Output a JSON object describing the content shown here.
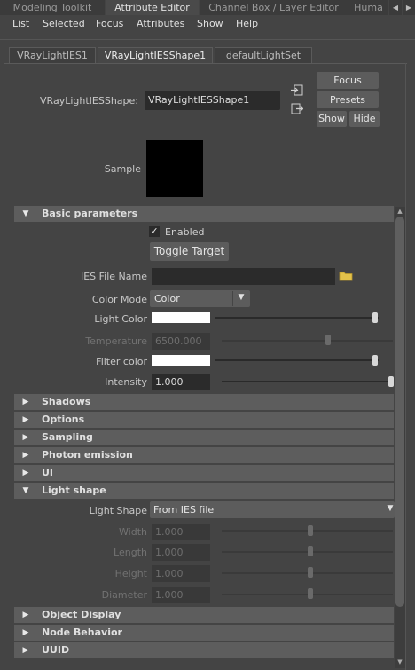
{
  "panel_tabs": [
    "Modeling Toolkit",
    "Attribute Editor",
    "Channel Box / Layer Editor",
    "Huma"
  ],
  "menu": [
    "List",
    "Selected",
    "Focus",
    "Attributes",
    "Show",
    "Help"
  ],
  "node_tabs": [
    "VRayLightIES1",
    "VRayLightIESShape1",
    "defaultLightSet"
  ],
  "header": {
    "node_label": "VRayLightIESShape:",
    "node_name": "VRayLightIESShape1",
    "focus": "Focus",
    "presets": "Presets",
    "show": "Show",
    "hide": "Hide",
    "sample_label": "Sample"
  },
  "basic": {
    "title": "Basic parameters",
    "enabled_label": "Enabled",
    "enabled": true,
    "toggle_target": "Toggle Target",
    "ies_file_label": "IES File Name",
    "ies_file_value": "",
    "color_mode_label": "Color Mode",
    "color_mode_value": "Color",
    "light_color_label": "Light Color",
    "light_color": "#ffffff",
    "temperature_label": "Temperature",
    "temperature_value": "6500.000",
    "filter_color_label": "Filter color",
    "filter_color": "#ffffff",
    "intensity_label": "Intensity",
    "intensity_value": "1.000"
  },
  "collapsed_sections": [
    "Shadows",
    "Options",
    "Sampling",
    "Photon emission",
    "UI"
  ],
  "light_shape": {
    "title": "Light shape",
    "shape_label": "Light Shape",
    "shape_value": "From IES file",
    "width_label": "Width",
    "width_value": "1.000",
    "length_label": "Length",
    "length_value": "1.000",
    "height_label": "Height",
    "height_value": "1.000",
    "diameter_label": "Diameter",
    "diameter_value": "1.000"
  },
  "bottom_sections": [
    "Object Display",
    "Node Behavior",
    "UUID"
  ]
}
